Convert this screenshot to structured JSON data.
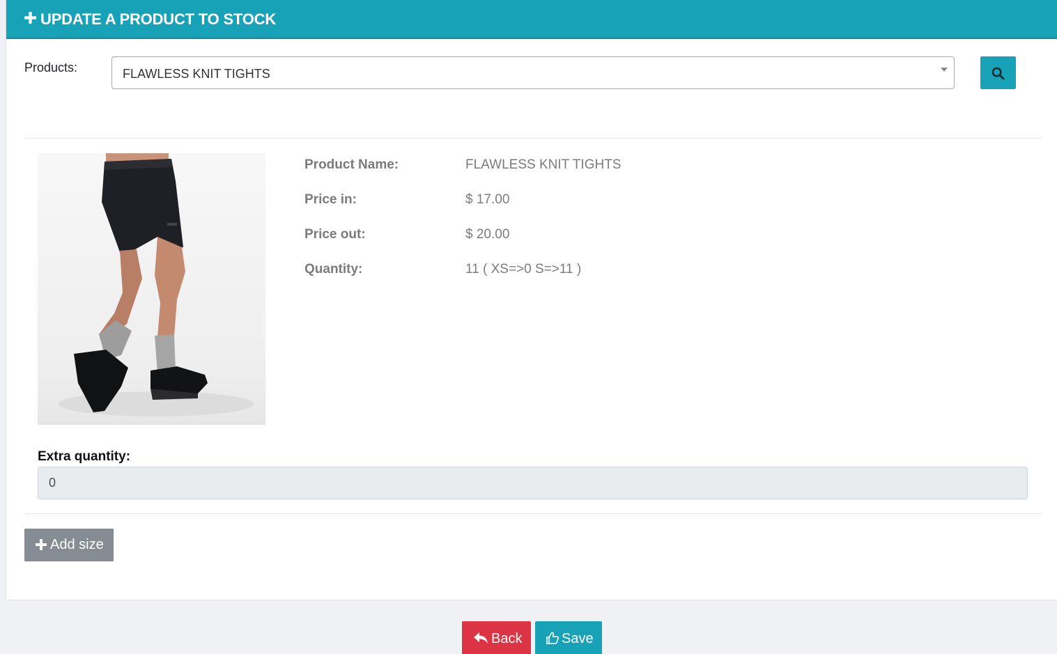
{
  "header": {
    "title": "UPDATE A PRODUCT TO STOCK",
    "icon": "plus-icon"
  },
  "product_selector": {
    "label": "Products:",
    "selected": "FLAWLESS KNIT TIGHTS",
    "search_icon": "search-icon"
  },
  "product": {
    "image_alt": "product photo",
    "fields": [
      {
        "label": "Product Name:",
        "value": "FLAWLESS KNIT TIGHTS"
      },
      {
        "label": "Price in:",
        "value": "$ 17.00"
      },
      {
        "label": "Price out:",
        "value": "$ 20.00"
      },
      {
        "label": "Quantity:",
        "value": "11 ( XS=>0 S=>11 )"
      }
    ]
  },
  "extra_quantity": {
    "label": "Extra quantity:",
    "value": "0"
  },
  "buttons": {
    "add_size": "Add size",
    "back": "Back",
    "save": "Save"
  },
  "colors": {
    "primary": "#18a2b8",
    "danger": "#dc3444",
    "secondary": "#858c93",
    "page_bg": "#f0f1f5"
  }
}
